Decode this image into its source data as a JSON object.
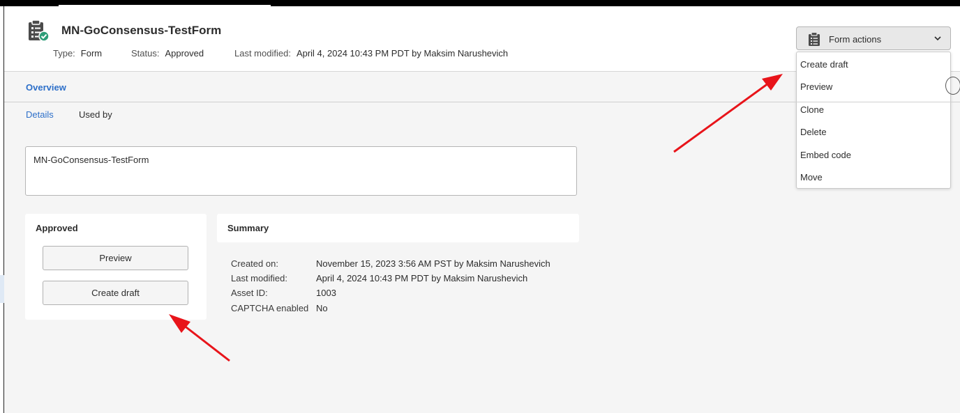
{
  "header": {
    "title": "MN-GoConsensus-TestForm",
    "type_label": "Type:",
    "type_value": "Form",
    "status_label": "Status:",
    "status_value": "Approved",
    "modified_label": "Last modified:",
    "modified_value": "April 4, 2024 10:43 PM PDT by Maksim Narushevich"
  },
  "form_actions": {
    "label": "Form actions",
    "menu": [
      "Create draft",
      "Preview",
      "Clone",
      "Delete",
      "Embed code",
      "Move"
    ]
  },
  "tabs": {
    "overview": "Overview",
    "details": "Details",
    "used_by": "Used by"
  },
  "name_field": {
    "value": "MN-GoConsensus-TestForm"
  },
  "approved_card": {
    "heading": "Approved",
    "preview_button": "Preview",
    "create_draft_button": "Create draft"
  },
  "summary": {
    "heading": "Summary",
    "rows": [
      {
        "key": "Created on:",
        "value": "November 15, 2023 3:56 AM PST by Maksim Narushevich"
      },
      {
        "key": "Last modified:",
        "value": "April 4, 2024 10:43 PM PDT by Maksim Narushevich"
      },
      {
        "key": "Asset ID:",
        "value": "1003"
      },
      {
        "key": "CAPTCHA enabled",
        "value": "No"
      }
    ]
  },
  "icons": {
    "form": "clipboard-check-icon",
    "form_actions": "clipboard-icon",
    "dropdown": "chevron-down-icon"
  },
  "colors": {
    "link_blue": "#2d6fc9",
    "approved_green": "#2d9d78",
    "annotation_arrow": "#e8141a",
    "background": "#f5f5f5"
  }
}
